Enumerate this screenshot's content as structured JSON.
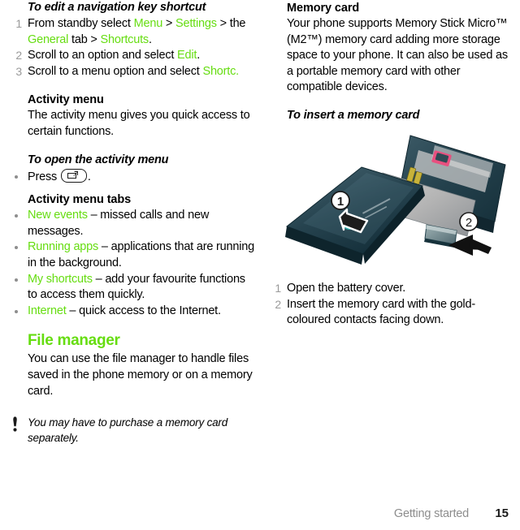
{
  "document": {
    "footer": {
      "section_name": "Getting started",
      "page_number": "15"
    },
    "accent_green": "#66dd11",
    "marker_gray": "#9a9a9a"
  },
  "left_column": {
    "procedure_edit_shortcut": {
      "title": "To edit a navigation key shortcut",
      "steps": [
        {
          "num": "1",
          "parts": [
            {
              "text": "From standby select ",
              "style": "plain"
            },
            {
              "text": "Menu",
              "style": "green"
            },
            {
              "text": " > ",
              "style": "plain"
            },
            {
              "text": "Settings",
              "style": "green"
            },
            {
              "text": " > the ",
              "style": "plain"
            },
            {
              "text": "General",
              "style": "green"
            },
            {
              "text": " tab > ",
              "style": "plain"
            },
            {
              "text": "Shortcuts",
              "style": "green"
            },
            {
              "text": ".",
              "style": "plain"
            }
          ]
        },
        {
          "num": "2",
          "parts": [
            {
              "text": "Scroll to an option and select ",
              "style": "plain"
            },
            {
              "text": "Edit",
              "style": "green"
            },
            {
              "text": ".",
              "style": "plain"
            }
          ]
        },
        {
          "num": "3",
          "parts": [
            {
              "text": "Scroll to a menu option and select ",
              "style": "plain"
            },
            {
              "text": "Shortc.",
              "style": "green"
            }
          ]
        }
      ]
    },
    "activity_menu": {
      "heading": "Activity menu",
      "body": "The activity menu gives you quick access to certain functions."
    },
    "procedure_open_activity_menu": {
      "title": "To open the activity menu",
      "bullet_prefix": "Press ",
      "key_icon": "activity-menu-key-icon",
      "bullet_suffix": "."
    },
    "activity_menu_tabs": {
      "heading": "Activity menu tabs",
      "items": [
        {
          "term": "New events",
          "desc": " – missed calls and new messages."
        },
        {
          "term": "Running apps",
          "desc": " – applications that are running in the background."
        },
        {
          "term": "My shortcuts",
          "desc": " – add your favourite functions to access them quickly."
        },
        {
          "term": "Internet",
          "desc": " – quick access to the Internet."
        }
      ]
    },
    "file_manager": {
      "heading": "File manager",
      "body": "You can use the file manager to handle files saved in the phone memory or on a memory card."
    },
    "note": {
      "icon": "exclamation-icon",
      "text": "You may have to purchase a memory card separately."
    }
  },
  "right_column": {
    "memory_card": {
      "heading": "Memory card",
      "body": "Your phone supports Memory Stick Micro™ (M2™) memory card adding more storage space to your phone. It can also be used as a portable memory card with other compatible devices."
    },
    "procedure_insert_memory_card": {
      "title": "To insert a memory card",
      "illustration": {
        "name": "phone-battery-cover-memory-card-illustration",
        "callout_1": "1",
        "callout_2": "2"
      },
      "steps": [
        {
          "num": "1",
          "text": "Open the battery cover."
        },
        {
          "num": "2",
          "text": "Insert the memory card with the gold-coloured contacts facing down."
        }
      ]
    }
  }
}
